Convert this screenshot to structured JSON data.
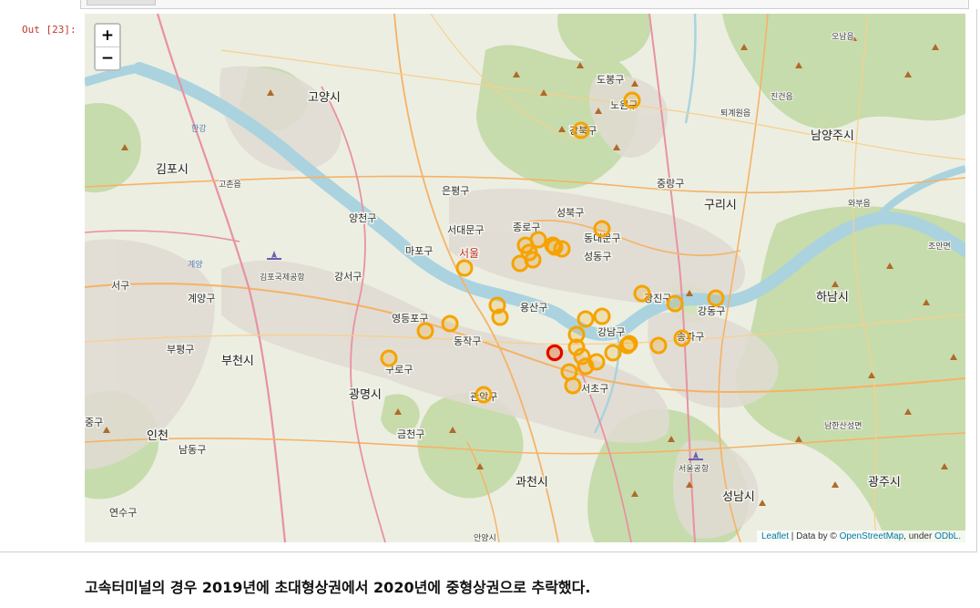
{
  "prompt_label": "Out [23]:",
  "zoom": {
    "in_label": "+",
    "out_label": "−"
  },
  "attribution": {
    "leaflet": "Leaflet",
    "data_by": " | Data by © ",
    "osm": "OpenStreetMap",
    "under": ", under ",
    "odbl": "ODbL."
  },
  "caption": "고속터미널의 경우 2019년에 초대형상권에서 2020년에 중형상권으로 추락했다.",
  "colors": {
    "marker_orange": "#f5a300",
    "marker_red": "#e00000",
    "water": "#aad3df",
    "park": "#c9deae",
    "forest": "#b7d39a"
  },
  "place_labels": {
    "cities": [
      "고양시",
      "김포시",
      "부천시",
      "광명시",
      "인천",
      "과천시",
      "성남시",
      "하남시",
      "광주시",
      "남양주시",
      "구리시"
    ],
    "districts": [
      "노원구",
      "강북구",
      "도봉구",
      "은평구",
      "서대문구",
      "종로구",
      "성북구",
      "동대문구",
      "성동구",
      "중랑구",
      "마포구",
      "강서구",
      "영등포구",
      "동작구",
      "구로구",
      "관악구",
      "용산구",
      "광진구",
      "강동구",
      "강남구",
      "서초구",
      "송파구",
      "양천구",
      "계양구",
      "부평구",
      "남동구",
      "연수구",
      "금천구",
      "서구",
      "중구"
    ],
    "towns": [
      "진건읍",
      "오남읍",
      "와부읍",
      "조안면",
      "고촌읍",
      "남한산성면",
      "퇴계원읍",
      "계양",
      "김포국제공항",
      "서울공항",
      "안양시"
    ],
    "seoul": "서울",
    "river": "한강"
  },
  "markers": [
    {
      "place": "노원구",
      "color": "orange"
    },
    {
      "place": "강북구",
      "color": "orange"
    },
    {
      "place": "동대문구",
      "color": "orange"
    },
    {
      "place": "종로구-1",
      "color": "orange"
    },
    {
      "place": "종로구-2",
      "color": "orange"
    },
    {
      "place": "종로구-3",
      "color": "orange"
    },
    {
      "place": "중구-1",
      "color": "orange"
    },
    {
      "place": "중구-2",
      "color": "orange"
    },
    {
      "place": "중구-3",
      "color": "orange"
    },
    {
      "place": "중구-4",
      "color": "orange"
    },
    {
      "place": "동대문구-2",
      "color": "orange"
    },
    {
      "place": "마포구",
      "color": "orange"
    },
    {
      "place": "용산구-1",
      "color": "orange"
    },
    {
      "place": "용산구-2",
      "color": "orange"
    },
    {
      "place": "영등포구-1",
      "color": "orange"
    },
    {
      "place": "영등포구-2",
      "color": "orange"
    },
    {
      "place": "구로구",
      "color": "orange"
    },
    {
      "place": "관악구",
      "color": "orange"
    },
    {
      "place": "성동구-1",
      "color": "orange"
    },
    {
      "place": "성동구-2",
      "color": "orange"
    },
    {
      "place": "광진구-1",
      "color": "orange"
    },
    {
      "place": "광진구-2",
      "color": "orange"
    },
    {
      "place": "강동구",
      "color": "orange"
    },
    {
      "place": "강남구-1",
      "color": "orange"
    },
    {
      "place": "강남구-2",
      "color": "orange"
    },
    {
      "place": "강남구-3",
      "color": "orange"
    },
    {
      "place": "강남구-4",
      "color": "orange"
    },
    {
      "place": "강남구-5",
      "color": "orange"
    },
    {
      "place": "강남구-6",
      "color": "orange"
    },
    {
      "place": "송파구-1",
      "color": "orange"
    },
    {
      "place": "송파구-2",
      "color": "orange"
    },
    {
      "place": "서초구-1",
      "color": "orange"
    },
    {
      "place": "서초구-2",
      "color": "orange"
    },
    {
      "place": "서초구-3",
      "color": "orange"
    },
    {
      "place": "서초구-4",
      "color": "orange"
    },
    {
      "place": "서초구-5",
      "color": "orange"
    },
    {
      "place": "고속터미널",
      "color": "red"
    }
  ]
}
